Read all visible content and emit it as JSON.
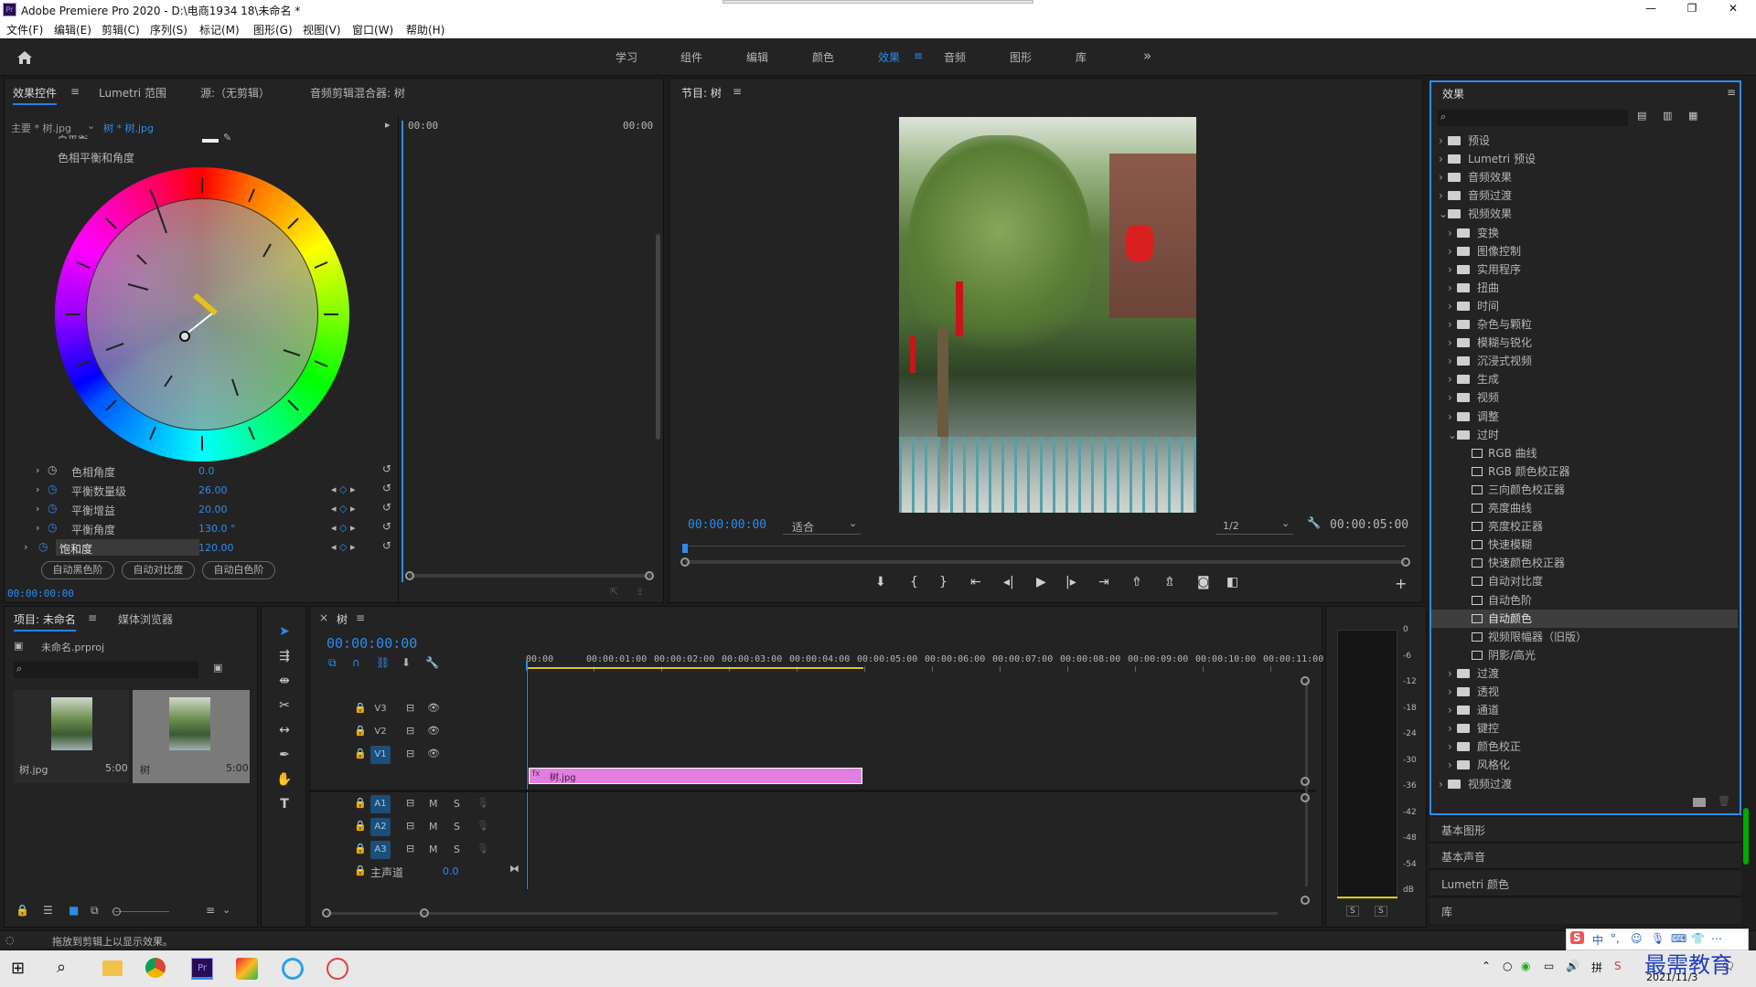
{
  "window": {
    "app_icon": "Pr",
    "title": "Adobe Premiere Pro 2020 - D:\\电商1934 18\\未命名 *",
    "controls": [
      "—",
      "❐",
      "✕"
    ]
  },
  "menu": [
    "文件(F)",
    "编辑(E)",
    "剪辑(C)",
    "序列(S)",
    "标记(M)",
    "图形(G)",
    "视图(V)",
    "窗口(W)",
    "帮助(H)"
  ],
  "workspaces": {
    "items": [
      "学习",
      "组件",
      "编辑",
      "颜色",
      "效果",
      "音频",
      "图形",
      "库"
    ],
    "active": "效果",
    "more": "»"
  },
  "effect_controls": {
    "tabs": [
      "效果控件",
      "Lumetri 范围",
      "源:（无剪辑）",
      "音频剪辑混合器: 树"
    ],
    "master": "主要 * 树.jpg",
    "clip": "树 * 树.jpg",
    "time_start": "00:00",
    "time_end": "00:00",
    "partial_row": "白平衡",
    "section": "色相平衡和角度",
    "params": [
      {
        "name": "色相角度",
        "value": "0.0"
      },
      {
        "name": "平衡数量级",
        "value": "26.00"
      },
      {
        "name": "平衡增益",
        "value": "20.00"
      },
      {
        "name": "平衡角度",
        "value": "130.0 °"
      },
      {
        "name": "饱和度",
        "value": "120.00"
      }
    ],
    "buttons": [
      "自动黑色阶",
      "自动对比度",
      "自动白色阶"
    ],
    "timecode": "00:00:00:00"
  },
  "program": {
    "title": "节目: 树",
    "timecode": "00:00:00:00",
    "fit": "适合",
    "resolution": "1/2",
    "duration": "00:00:05:00"
  },
  "effects_panel": {
    "title": "效果",
    "tree": [
      {
        "label": "预设",
        "type": "folder",
        "level": 0,
        "open": false
      },
      {
        "label": "Lumetri 预设",
        "type": "folder",
        "level": 0,
        "open": false
      },
      {
        "label": "音频效果",
        "type": "folder",
        "level": 0,
        "open": false
      },
      {
        "label": "音频过渡",
        "type": "folder",
        "level": 0,
        "open": false
      },
      {
        "label": "视频效果",
        "type": "folder",
        "level": 0,
        "open": true
      },
      {
        "label": "变换",
        "type": "folder",
        "level": 1,
        "open": false
      },
      {
        "label": "图像控制",
        "type": "folder",
        "level": 1,
        "open": false
      },
      {
        "label": "实用程序",
        "type": "folder",
        "level": 1,
        "open": false
      },
      {
        "label": "扭曲",
        "type": "folder",
        "level": 1,
        "open": false
      },
      {
        "label": "时间",
        "type": "folder",
        "level": 1,
        "open": false
      },
      {
        "label": "杂色与颗粒",
        "type": "folder",
        "level": 1,
        "open": false
      },
      {
        "label": "模糊与锐化",
        "type": "folder",
        "level": 1,
        "open": false
      },
      {
        "label": "沉浸式视频",
        "type": "folder",
        "level": 1,
        "open": false
      },
      {
        "label": "生成",
        "type": "folder",
        "level": 1,
        "open": false
      },
      {
        "label": "视频",
        "type": "folder",
        "level": 1,
        "open": false
      },
      {
        "label": "调整",
        "type": "folder",
        "level": 1,
        "open": false
      },
      {
        "label": "过时",
        "type": "folder",
        "level": 1,
        "open": true
      },
      {
        "label": "RGB 曲线",
        "type": "preset",
        "level": 2
      },
      {
        "label": "RGB 颜色校正器",
        "type": "preset",
        "level": 2
      },
      {
        "label": "三向颜色校正器",
        "type": "preset",
        "level": 2
      },
      {
        "label": "亮度曲线",
        "type": "preset",
        "level": 2
      },
      {
        "label": "亮度校正器",
        "type": "preset",
        "level": 2
      },
      {
        "label": "快速模糊",
        "type": "preset",
        "level": 2
      },
      {
        "label": "快速颜色校正器",
        "type": "preset",
        "level": 2
      },
      {
        "label": "自动对比度",
        "type": "preset",
        "level": 2
      },
      {
        "label": "自动色阶",
        "type": "preset",
        "level": 2
      },
      {
        "label": "自动颜色",
        "type": "preset",
        "level": 2,
        "selected": true
      },
      {
        "label": "视频限幅器（旧版）",
        "type": "preset",
        "level": 2
      },
      {
        "label": "阴影/高光",
        "type": "preset",
        "level": 2
      },
      {
        "label": "过渡",
        "type": "folder",
        "level": 1,
        "open": false
      },
      {
        "label": "透视",
        "type": "folder",
        "level": 1,
        "open": false
      },
      {
        "label": "通道",
        "type": "folder",
        "level": 1,
        "open": false
      },
      {
        "label": "键控",
        "type": "folder",
        "level": 1,
        "open": false
      },
      {
        "label": "颜色校正",
        "type": "folder",
        "level": 1,
        "open": false
      },
      {
        "label": "风格化",
        "type": "folder",
        "level": 1,
        "open": false
      },
      {
        "label": "视频过渡",
        "type": "folder",
        "level": 0,
        "open": false
      }
    ],
    "collapsed_panels": [
      "基本图形",
      "基本声音",
      "Lumetri 颜色",
      "库"
    ]
  },
  "project": {
    "tabs": [
      "项目: 未命名",
      "媒体浏览器"
    ],
    "file": "未命名.prproj",
    "items": [
      {
        "name": "树.jpg",
        "duration": "5:00"
      },
      {
        "name": "树",
        "duration": "5:00"
      }
    ]
  },
  "timeline": {
    "title": "树",
    "timecode": "00:00:00:00",
    "ruler": [
      "00:00",
      "00:00:01:00",
      "00:00:02:00",
      "00:00:03:00",
      "00:00:04:00",
      "00:00:05:00",
      "00:00:06:00",
      "00:00:07:00",
      "00:00:08:00",
      "00:00:09:00",
      "00:00:10:00",
      "00:00:11:00"
    ],
    "video_tracks": [
      "V3",
      "V2",
      "V1"
    ],
    "audio_tracks": [
      "A1",
      "A2",
      "A3"
    ],
    "master": "主声道",
    "master_value": "0.0",
    "clip": "树.jpg",
    "mute": "M",
    "solo": "S"
  },
  "meter": {
    "scale": [
      "0",
      "-6",
      "-12",
      "-18",
      "-24",
      "-30",
      "-36",
      "-42",
      "-48",
      "-54",
      "dB"
    ],
    "solo": [
      "S",
      "S"
    ]
  },
  "status": "拖放到剪辑上以显示效果。",
  "taskbar": {
    "tray_text": "中",
    "date": "2021/11/3",
    "watermark": "最需教育"
  },
  "colors": {
    "accent": "#2d8ceb",
    "clip": "#e27ee0",
    "work_area": "#d7c52a",
    "bg": "#232323"
  }
}
